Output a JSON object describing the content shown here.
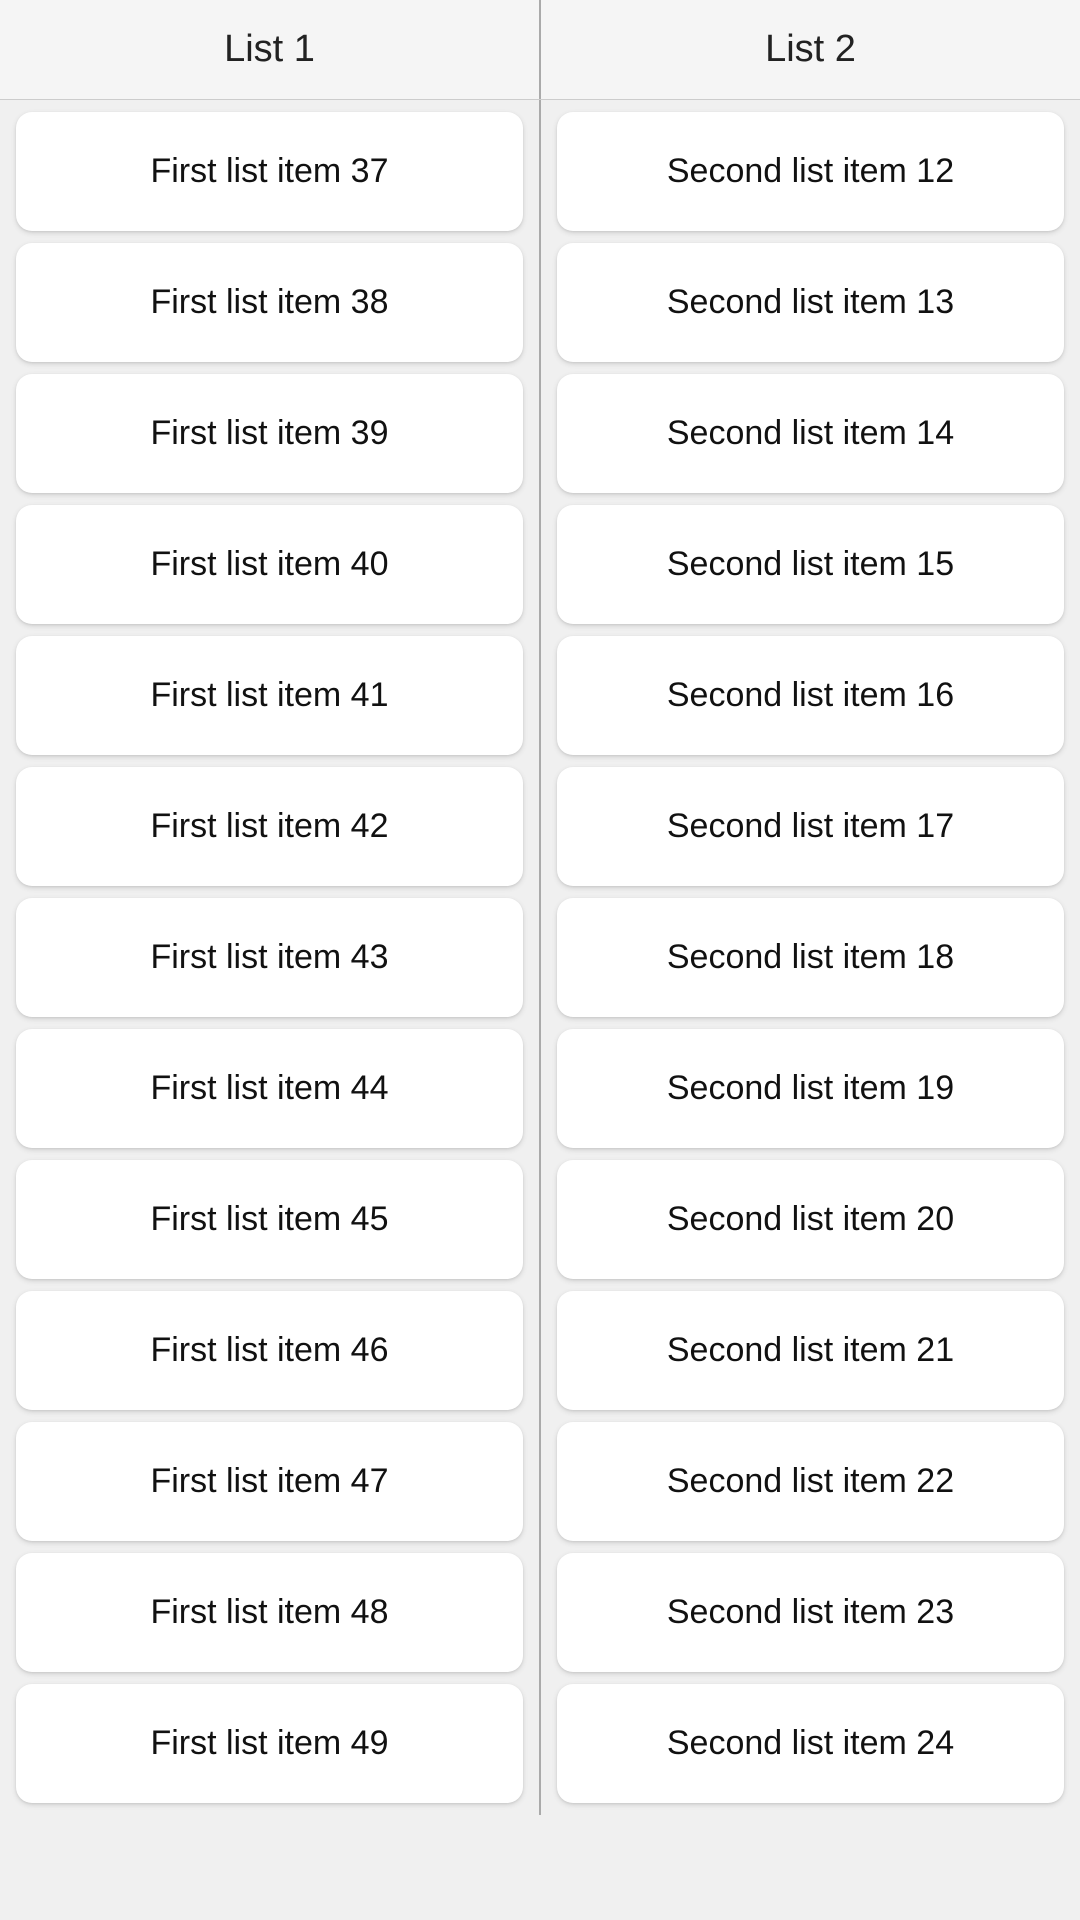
{
  "header": {
    "list1_label": "List 1",
    "list2_label": "List 2"
  },
  "list1": [
    "First list item 37",
    "First list item 38",
    "First list item 39",
    "First list item 40",
    "First list item 41",
    "First list item 42",
    "First list item 43",
    "First list item 44",
    "First list item 45",
    "First list item 46",
    "First list item 47",
    "First list item 48",
    "First list item 49"
  ],
  "list2": [
    "Second list item 12",
    "Second list item 13",
    "Second list item 14",
    "Second list item 15",
    "Second list item 16",
    "Second list item 17",
    "Second list item 18",
    "Second list item 19",
    "Second list item 20",
    "Second list item 21",
    "Second list item 22",
    "Second list item 23",
    "Second list item 24"
  ]
}
